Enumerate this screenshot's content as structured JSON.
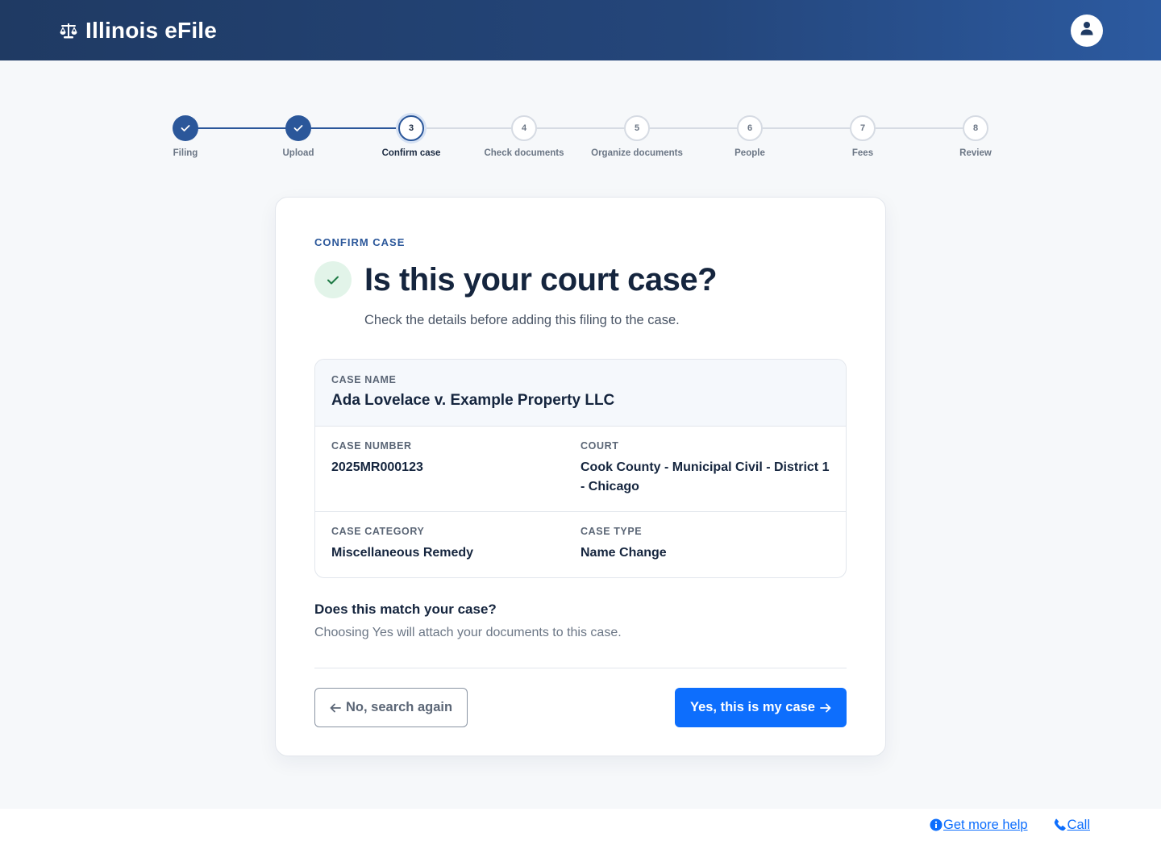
{
  "header": {
    "title": "Illinois eFile",
    "logo_icon": "scale-balance-icon",
    "avatar_icon": "user-icon"
  },
  "stepper": {
    "steps": [
      {
        "number": "1",
        "label": "Filing",
        "state": "done"
      },
      {
        "number": "2",
        "label": "Upload",
        "state": "done"
      },
      {
        "number": "3",
        "label": "Confirm case",
        "state": "current"
      },
      {
        "number": "4",
        "label": "Check documents",
        "state": "todo"
      },
      {
        "number": "5",
        "label": "Organize documents",
        "state": "todo"
      },
      {
        "number": "6",
        "label": "People",
        "state": "todo"
      },
      {
        "number": "7",
        "label": "Fees",
        "state": "todo"
      },
      {
        "number": "8",
        "label": "Review",
        "state": "todo"
      }
    ]
  },
  "card": {
    "eyebrow": "CONFIRM CASE",
    "headline": "Is this your court case?",
    "subline": "Check the details before adding this filing to the case.",
    "case_name_label": "CASE NAME",
    "case_name": "Ada Lovelace v. Example Property LLC",
    "case_number_label": "CASE NUMBER",
    "case_number": "2025MR000123",
    "court_label": "COURT",
    "court": "Cook County - Municipal Civil - District 1 - Chicago",
    "case_category_label": "CASE CATEGORY",
    "case_category": "Miscellaneous Remedy",
    "case_type_label": "CASE TYPE",
    "case_type": "Name Change",
    "question": "Does this match your case?",
    "question_sub": "Choosing Yes will attach your documents to this case.",
    "no_button": "No, search again",
    "yes_button": "Yes, this is my case"
  },
  "footer": {
    "help_link": "Get more help",
    "call_link": "Call"
  },
  "colors": {
    "header_start": "#1f3a63",
    "header_end": "#2c5aa0",
    "step_done": "#2b579a",
    "primary_button": "#0d6efd",
    "success_badge": "#e2f4e9"
  }
}
